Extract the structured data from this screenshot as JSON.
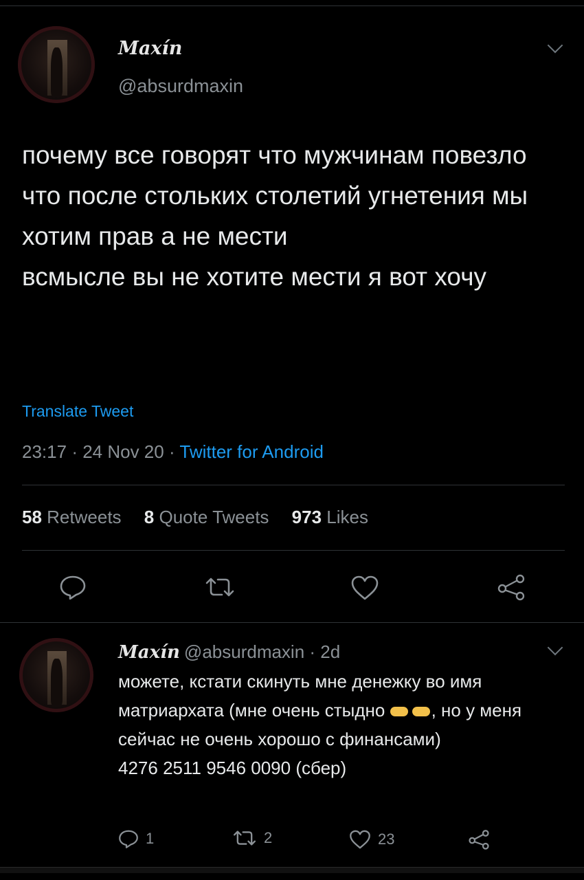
{
  "tweet": {
    "author_name": "Maxín",
    "author_handle": "@absurdmaxin",
    "text": "почему все говорят что мужчинам повезло что после стольких столетий угнетения мы хотим прав а не мести\nвсмысле вы не хотите мести я вот хочу",
    "translate_label": "Translate Tweet",
    "time": "23:17",
    "date": "24 Nov 20",
    "source": "Twitter for Android",
    "stats": {
      "retweets_count": "58",
      "retweets_label": "Retweets",
      "quotes_count": "8",
      "quotes_label": "Quote Tweets",
      "likes_count": "973",
      "likes_label": "Likes"
    },
    "actions": [
      "reply-icon",
      "retweet-icon",
      "like-icon",
      "share-icon"
    ]
  },
  "reply": {
    "author_name": "Maxín",
    "author_handle": "@absurdmaxin",
    "age": "2d",
    "text_before_emoji": "можете, кстати скинуть мне денежку во имя матриархата (мне очень стыдно ",
    "text_after_emoji": ", но у меня сейчас не очень хорошо с финансами)\n4276 2511 9546 0090 (сбер)",
    "emoji": "pointing-fingers-emoji",
    "reply_count": "1",
    "retweet_count": "2",
    "like_count": "23"
  },
  "colors": {
    "background": "#000000",
    "text": "#e7e9ea",
    "muted": "#8b9196",
    "accent": "#1d9bf0"
  }
}
